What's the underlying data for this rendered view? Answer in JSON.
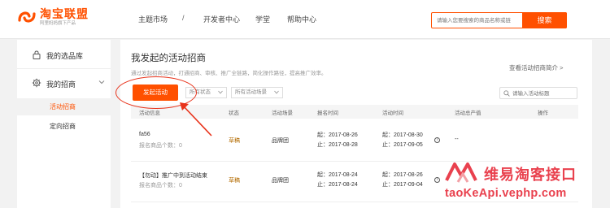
{
  "header": {
    "logo_title": "淘宝联盟",
    "logo_subtitle": "阿里妈妈旗下产品",
    "nav": [
      "主题市场",
      "/",
      "开发者中心",
      "学堂",
      "帮助中心"
    ],
    "search_placeholder": "请输入您要搜索的商品名称或链",
    "search_button": "搜索",
    "brand_color": "#ff5000"
  },
  "sidebar": {
    "items": [
      {
        "label": "我的选品库",
        "icon": "lock-icon"
      },
      {
        "label": "我的招商",
        "icon": "gear-icon",
        "expanded": true
      }
    ],
    "subitems": [
      {
        "label": "活动招商",
        "active": true
      },
      {
        "label": "定向招商",
        "active": false
      }
    ]
  },
  "main": {
    "title": "我发起的活动招商",
    "intro": "通过发起招商活动，打通招商、审核、推广全链路，简化操作路径，提高推广效率。",
    "intro_link": "查看活动招商简介 >",
    "create_button": "发起活动",
    "filter_status": "所有状态",
    "filter_scene": "所有活动场景",
    "search_placeholder": "请输入活动标题",
    "columns": [
      "活动信息",
      "状态",
      "活动场景",
      "报名时间",
      "活动时间",
      "活动总产值",
      "操作"
    ],
    "rows": [
      {
        "name": "fa56",
        "count_label": "报名商品个数：0",
        "status": "草稿",
        "scene": "品牌团",
        "signup_start": "起：2017-08-26",
        "signup_end": "止：2017-08-28",
        "activity_start": "起：2017-08-30",
        "activity_end": "止：2017-09-05",
        "total": "--"
      },
      {
        "name": "【勿动】推广中到活动结束",
        "count_label": "报名商品个数：0",
        "status": "草稿",
        "scene": "品牌团",
        "signup_start": "起：2017-08-24",
        "signup_end": "止：2017-08-24",
        "activity_start": "起：2017-08-26",
        "activity_end": "止：2017-09-04",
        "total": ""
      }
    ]
  },
  "watermark": {
    "text": "维易淘客接口",
    "url": "taoKeApi.vephp.com",
    "color": "#e9414e"
  },
  "annotation_color": "#e8331b"
}
